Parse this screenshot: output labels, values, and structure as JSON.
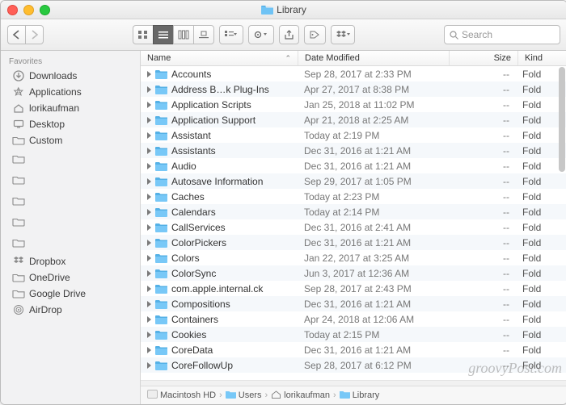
{
  "window": {
    "title": "Library"
  },
  "toolbar": {
    "search_placeholder": "Search"
  },
  "sidebar": {
    "section_label": "Favorites",
    "items": [
      {
        "label": "Downloads",
        "icon": "downloads"
      },
      {
        "label": "Applications",
        "icon": "applications"
      },
      {
        "label": "lorikaufman",
        "icon": "home"
      },
      {
        "label": "Desktop",
        "icon": "desktop"
      },
      {
        "label": "Custom",
        "icon": "folder"
      }
    ],
    "blurred_item_count": 5,
    "items2": [
      {
        "label": "Dropbox",
        "icon": "dropbox"
      },
      {
        "label": "OneDrive",
        "icon": "folder"
      },
      {
        "label": "Google Drive",
        "icon": "folder"
      },
      {
        "label": "AirDrop",
        "icon": "airdrop"
      }
    ]
  },
  "columns": {
    "name": "Name",
    "date": "Date Modified",
    "size": "Size",
    "kind": "Kind",
    "sort_column": "name",
    "sort_dir": "asc"
  },
  "rows": [
    {
      "name": "Accounts",
      "date": "Sep 28, 2017 at 2:33 PM",
      "size": "--",
      "kind": "Folder"
    },
    {
      "name": "Address B…k Plug-Ins",
      "date": "Apr 27, 2017 at 8:38 PM",
      "size": "--",
      "kind": "Folder"
    },
    {
      "name": "Application Scripts",
      "date": "Jan 25, 2018 at 11:02 PM",
      "size": "--",
      "kind": "Folder"
    },
    {
      "name": "Application Support",
      "date": "Apr 21, 2018 at 2:25 AM",
      "size": "--",
      "kind": "Folder"
    },
    {
      "name": "Assistant",
      "date": "Today at 2:19 PM",
      "size": "--",
      "kind": "Folder"
    },
    {
      "name": "Assistants",
      "date": "Dec 31, 2016 at 1:21 AM",
      "size": "--",
      "kind": "Folder"
    },
    {
      "name": "Audio",
      "date": "Dec 31, 2016 at 1:21 AM",
      "size": "--",
      "kind": "Folder"
    },
    {
      "name": "Autosave Information",
      "date": "Sep 29, 2017 at 1:05 PM",
      "size": "--",
      "kind": "Folder"
    },
    {
      "name": "Caches",
      "date": "Today at 2:23 PM",
      "size": "--",
      "kind": "Folder"
    },
    {
      "name": "Calendars",
      "date": "Today at 2:14 PM",
      "size": "--",
      "kind": "Folder"
    },
    {
      "name": "CallServices",
      "date": "Dec 31, 2016 at 2:41 AM",
      "size": "--",
      "kind": "Folder"
    },
    {
      "name": "ColorPickers",
      "date": "Dec 31, 2016 at 1:21 AM",
      "size": "--",
      "kind": "Folder"
    },
    {
      "name": "Colors",
      "date": "Jan 22, 2017 at 3:25 AM",
      "size": "--",
      "kind": "Folder"
    },
    {
      "name": "ColorSync",
      "date": "Jun 3, 2017 at 12:36 AM",
      "size": "--",
      "kind": "Folder"
    },
    {
      "name": "com.apple.internal.ck",
      "date": "Sep 28, 2017 at 2:43 PM",
      "size": "--",
      "kind": "Folder"
    },
    {
      "name": "Compositions",
      "date": "Dec 31, 2016 at 1:21 AM",
      "size": "--",
      "kind": "Folder"
    },
    {
      "name": "Containers",
      "date": "Apr 24, 2018 at 12:06 AM",
      "size": "--",
      "kind": "Folder"
    },
    {
      "name": "Cookies",
      "date": "Today at 2:15 PM",
      "size": "--",
      "kind": "Folder"
    },
    {
      "name": "CoreData",
      "date": "Dec 31, 2016 at 1:21 AM",
      "size": "--",
      "kind": "Folder"
    },
    {
      "name": "CoreFollowUp",
      "date": "Sep 28, 2017 at 6:12 PM",
      "size": "--",
      "kind": "Folder"
    }
  ],
  "path": [
    {
      "label": "Macintosh HD",
      "icon": "disk"
    },
    {
      "label": "Users",
      "icon": "folder"
    },
    {
      "label": "lorikaufman",
      "icon": "home"
    },
    {
      "label": "Library",
      "icon": "folder"
    }
  ],
  "watermark": "groovyPost.com"
}
